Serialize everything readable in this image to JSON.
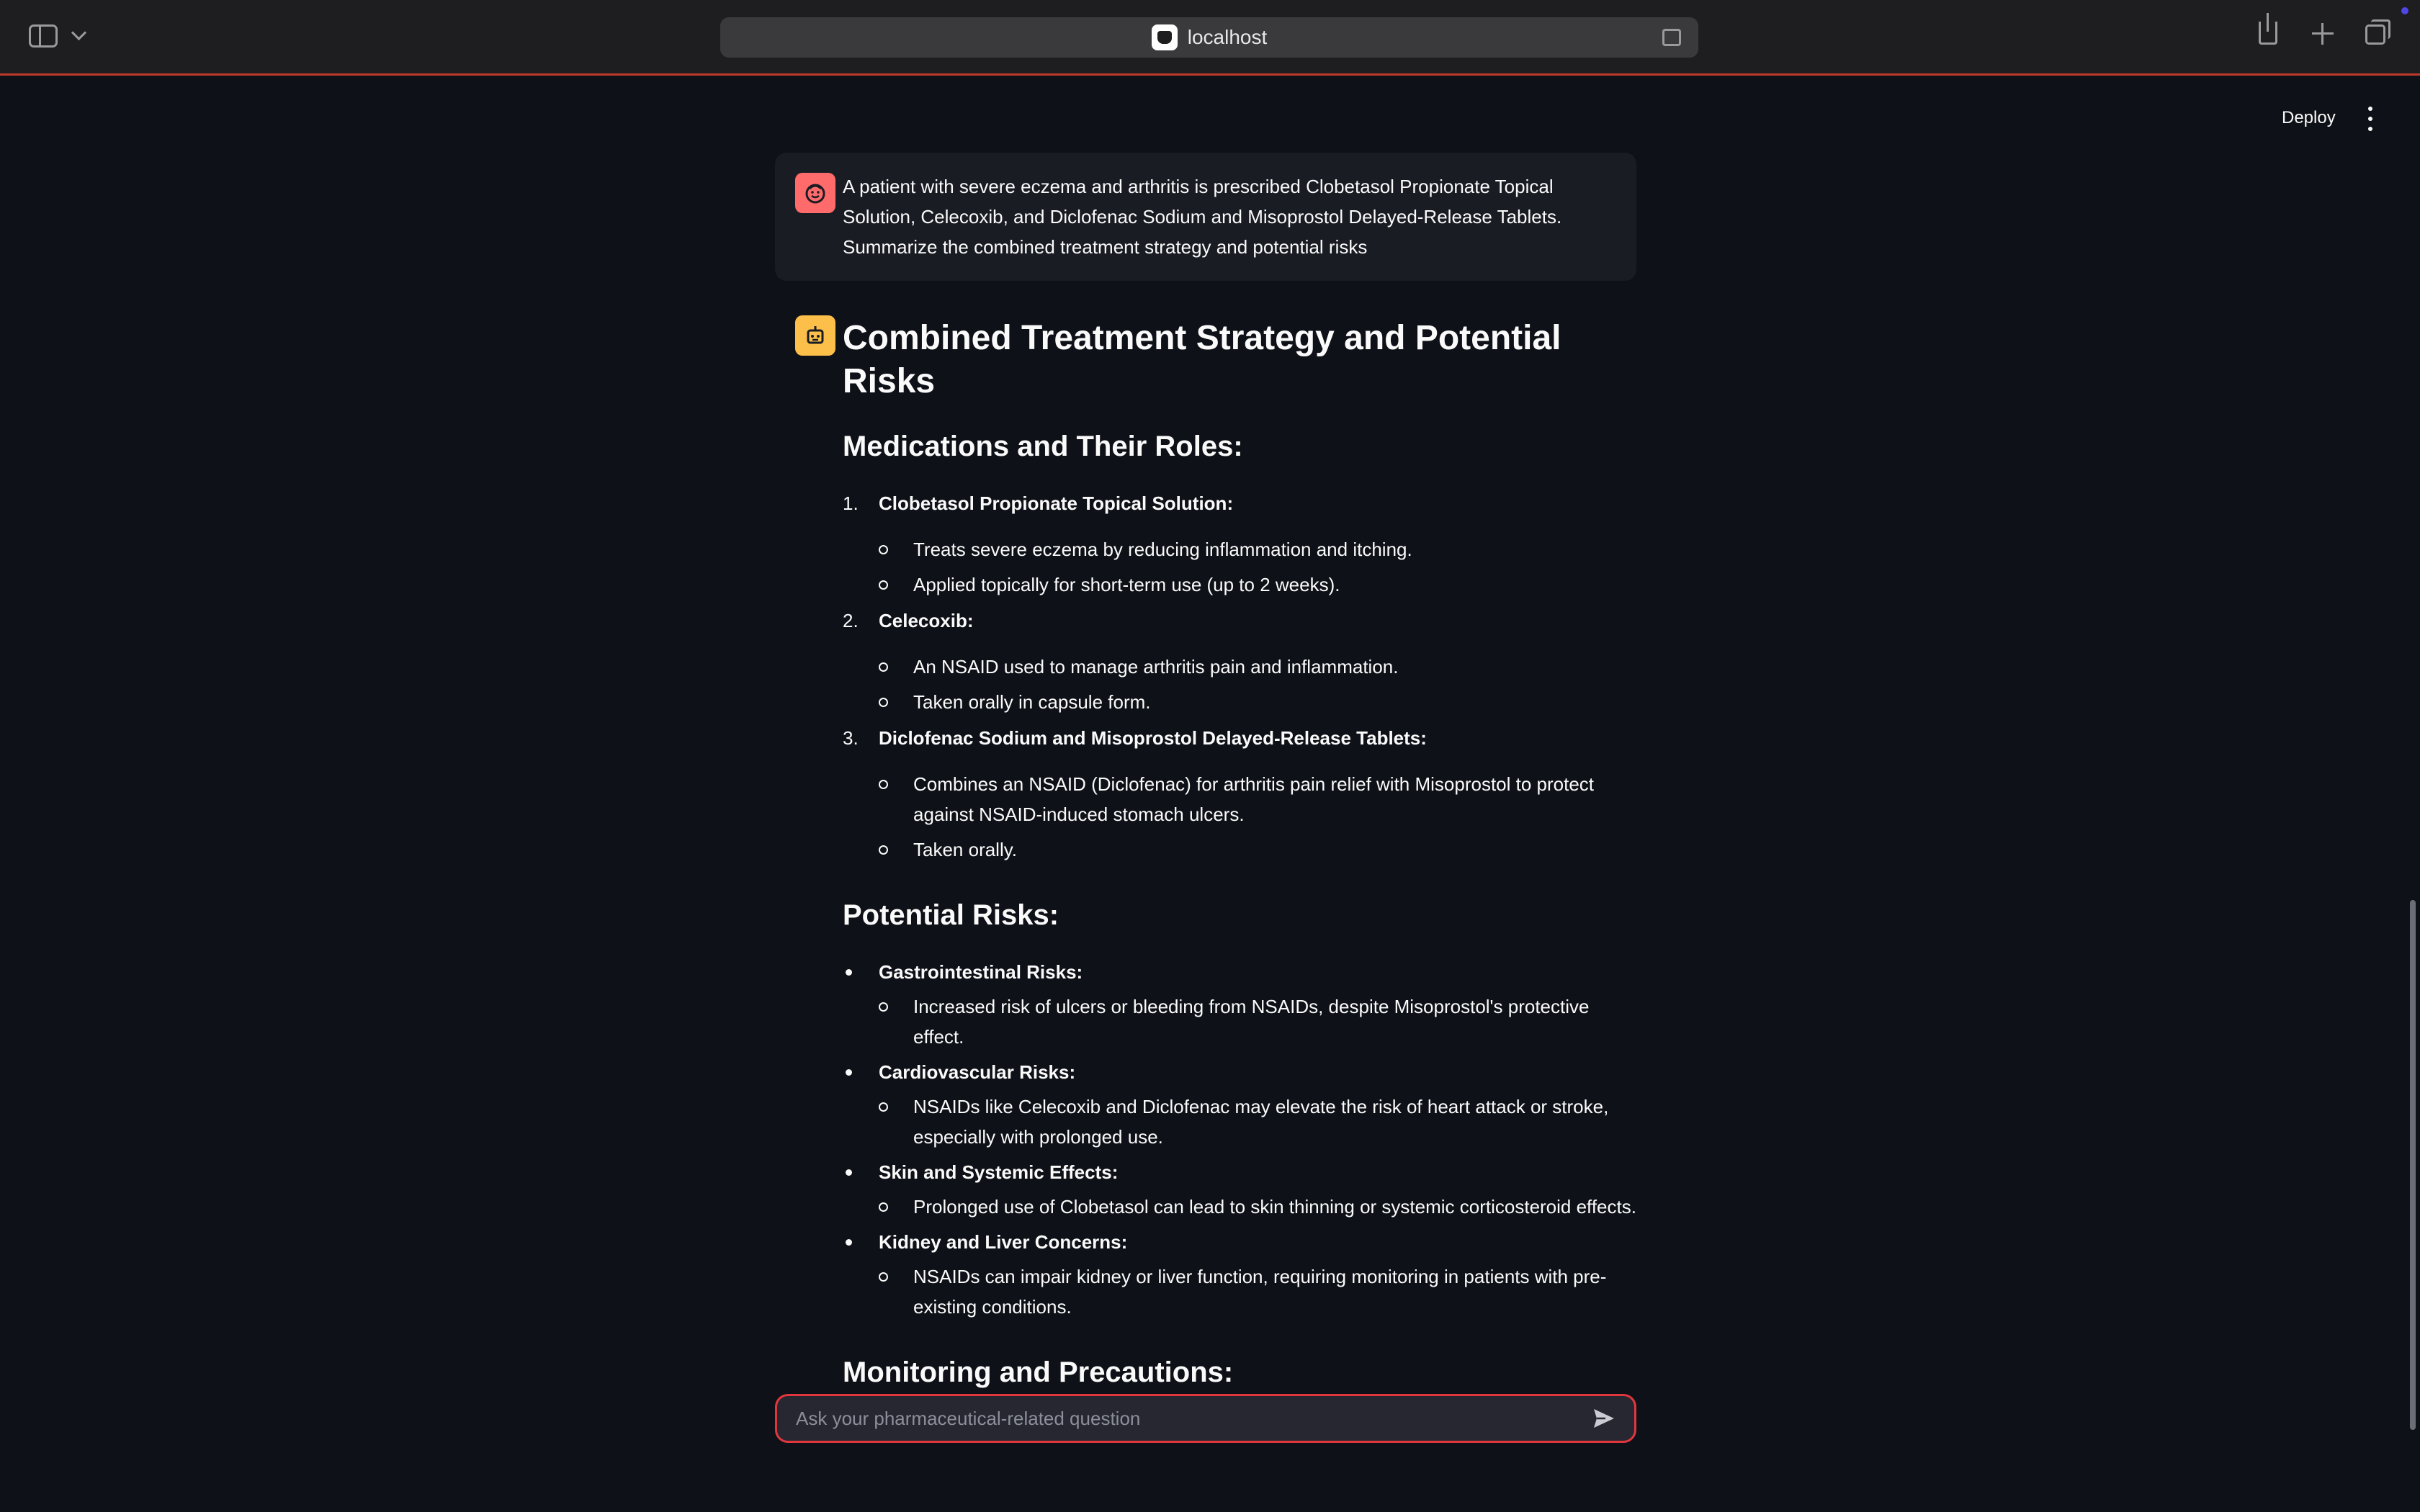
{
  "browser": {
    "url": "localhost"
  },
  "header": {
    "deploy_label": "Deploy"
  },
  "user_message": {
    "text": "A patient with severe eczema and arthritis is prescribed Clobetasol Propionate Topical Solution, Celecoxib, and Diclofenac Sodium and Misoprostol Delayed-Release Tablets. Summarize the combined treatment strategy and potential risks"
  },
  "assistant_message": {
    "title": "Combined Treatment Strategy and Potential Risks",
    "medications_heading": "Medications and Their Roles:",
    "medications": [
      {
        "num": "1.",
        "name": "Clobetasol Propionate Topical Solution",
        "colon": ":",
        "points": [
          "Treats severe eczema by reducing inflammation and itching.",
          "Applied topically for short-term use (up to 2 weeks)."
        ]
      },
      {
        "num": "2.",
        "name": "Celecoxib",
        "colon": ":",
        "points": [
          "An NSAID used to manage arthritis pain and inflammation.",
          "Taken orally in capsule form."
        ]
      },
      {
        "num": "3.",
        "name": "Diclofenac Sodium and Misoprostol Delayed-Release Tablets",
        "colon": ":",
        "points": [
          "Combines an NSAID (Diclofenac) for arthritis pain relief with Misoprostol to protect against NSAID-induced stomach ulcers.",
          "Taken orally."
        ]
      }
    ],
    "risks_heading": "Potential Risks:",
    "risks": [
      {
        "name": "Gastrointestinal Risks",
        "colon": ":",
        "points": [
          "Increased risk of ulcers or bleeding from NSAIDs, despite Misoprostol's protective effect."
        ]
      },
      {
        "name": "Cardiovascular Risks",
        "colon": ":",
        "points": [
          "NSAIDs like Celecoxib and Diclofenac may elevate the risk of heart attack or stroke, especially with prolonged use."
        ]
      },
      {
        "name": "Skin and Systemic Effects",
        "colon": ":",
        "points": [
          "Prolonged use of Clobetasol can lead to skin thinning or systemic corticosteroid effects."
        ]
      },
      {
        "name": "Kidney and Liver Concerns",
        "colon": ":",
        "points": [
          "NSAIDs can impair kidney or liver function, requiring monitoring in patients with pre-existing conditions."
        ]
      }
    ],
    "monitoring_heading": "Monitoring and Precautions:"
  },
  "chat_input": {
    "placeholder": "Ask your pharmaceutical-related question",
    "value": ""
  },
  "colors": {
    "background": "#0e1117",
    "user_avatar": "#ff6b6b",
    "bot_avatar": "#fcbf49",
    "input_border": "#e0373f"
  },
  "icons": {
    "user_avatar": "smiling-face-icon",
    "bot_avatar": "robot-icon",
    "send": "send-arrow-icon"
  }
}
